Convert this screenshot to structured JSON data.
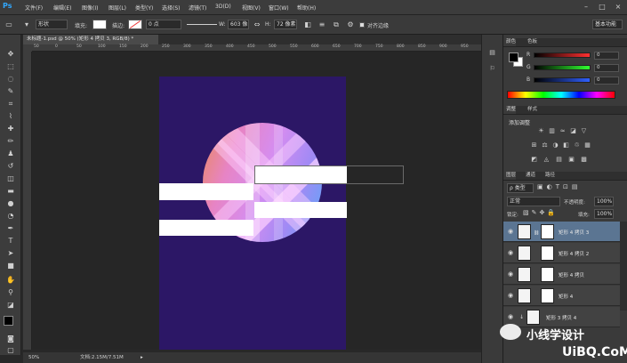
{
  "app": {
    "logo": "Ps",
    "menus": [
      "文件(F)",
      "编辑(E)",
      "图像(I)",
      "图层(L)",
      "类型(Y)",
      "选择(S)",
      "滤镜(T)",
      "3D(D)",
      "视图(V)",
      "窗口(W)",
      "帮助(H)"
    ],
    "window_buttons": [
      "–",
      "□",
      "×"
    ]
  },
  "options_bar": {
    "shape_mode": "形状",
    "fill_label": "填充:",
    "stroke_label": "描边:",
    "stroke_width": "0 点",
    "w_label": "W:",
    "w_value": "603 像",
    "h_label": "H:",
    "h_value": "72 像素",
    "align_edges": "对齐边缘",
    "workspace": "基本功能"
  },
  "document": {
    "tab_title": "未标题-1.psd @ 50% (矩形 4 拷贝 3, RGB/8) *",
    "zoom": "50%",
    "doc_info": "文档:2.15M/7.51M"
  },
  "ruler_numbers": [
    "50",
    "0",
    "50",
    "100",
    "150",
    "200",
    "250",
    "300",
    "350",
    "400",
    "450",
    "500",
    "550",
    "600",
    "650",
    "700",
    "750",
    "800",
    "850",
    "900",
    "950"
  ],
  "color_panel": {
    "tabs": [
      "颜色",
      "色板"
    ],
    "channels": [
      {
        "label": "R",
        "value": "0",
        "color": "#ff3030"
      },
      {
        "label": "G",
        "value": "0",
        "color": "#30ff30"
      },
      {
        "label": "B",
        "value": "0",
        "color": "#3060ff"
      }
    ]
  },
  "adjust_panel": {
    "tabs": [
      "调整",
      "样式"
    ],
    "title": "添加调整",
    "icons_row1": [
      "☀",
      "▥",
      "≈",
      "◪",
      "▽"
    ],
    "icons_row2": [
      "⊞",
      "⚖",
      "◑",
      "◧",
      "♲",
      "▦"
    ],
    "icons_row3": [
      "◩",
      "◬",
      "▤",
      "▣",
      "▩"
    ]
  },
  "layers_panel": {
    "tabs": [
      "图层",
      "通道",
      "路径"
    ],
    "kind_filter": "ρ 类型",
    "blend_mode": "正常",
    "opacity_label": "不透明度:",
    "opacity_value": "100%",
    "lock_label": "锁定:",
    "fill_label": "填充:",
    "fill_value": "100%",
    "layers": [
      {
        "name": "矩形 4 拷贝 3",
        "selected": true
      },
      {
        "name": "矩形 4 拷贝 2",
        "selected": false
      },
      {
        "name": "矩形 4 拷贝",
        "selected": false
      },
      {
        "name": "矩形 4",
        "selected": false
      },
      {
        "name": "矩形 3 拷贝 4",
        "selected": false
      }
    ]
  },
  "watermark": {
    "text_cn": "小线学设计",
    "text_logo": "UiBQ.CoM"
  },
  "colors": {
    "artboard": "#2c1766",
    "selection": "#5b7592"
  }
}
